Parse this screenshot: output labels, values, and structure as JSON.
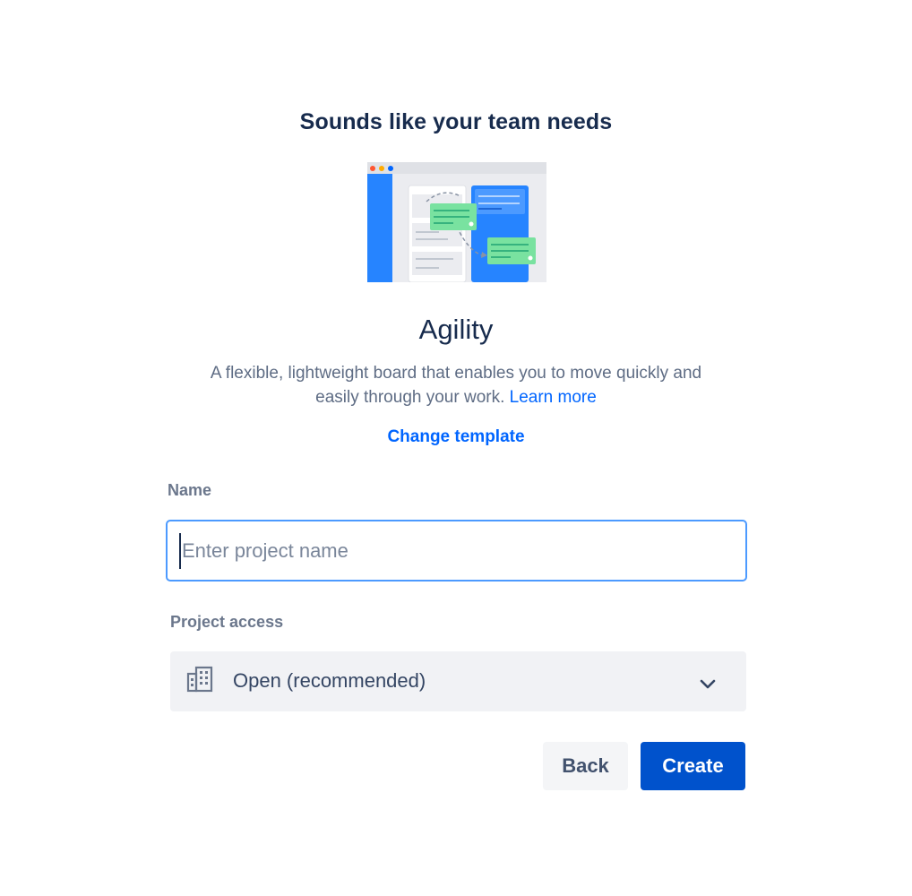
{
  "heading": "Sounds like your team needs",
  "template": {
    "name": "Agility",
    "description": "A flexible, lightweight board that enables you to move quickly and easily through your work.",
    "learn_more": "Learn more",
    "change_label": "Change template"
  },
  "form": {
    "name_label": "Name",
    "name_placeholder": "Enter project name",
    "name_value": "",
    "access_label": "Project access",
    "access_value": "Open (recommended)",
    "access_icon": "building-icon"
  },
  "actions": {
    "back_label": "Back",
    "create_label": "Create"
  },
  "colors": {
    "primary": "#0052CC",
    "link": "#0065FF",
    "focus_border": "#4C9AFF",
    "text_dark": "#172B4D",
    "text_subtle": "#5E6C84",
    "field_bg": "#F1F2F5"
  }
}
